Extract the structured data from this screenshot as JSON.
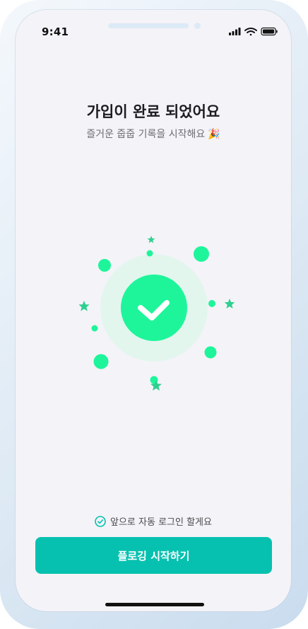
{
  "status_bar": {
    "time": "9:41",
    "icons": [
      "cellular-signal-icon",
      "wifi-icon",
      "battery-icon"
    ]
  },
  "header": {
    "title": "가입이 완료 되었어요",
    "subtitle": "즐거운 줍줍 기록을 시작해요",
    "subtitle_emoji": "🎉"
  },
  "illustration": {
    "icon": "check-circle-icon",
    "colors": {
      "accent": "#1ef59b",
      "halo": "#e2f6ee",
      "star": "#2ecf8f"
    }
  },
  "footer": {
    "auto_login_label": "앞으로 자동 로그인 할게요",
    "auto_login_checked": true,
    "start_button_label": "플로깅 시작하기",
    "button_color": "#06c1b0"
  }
}
